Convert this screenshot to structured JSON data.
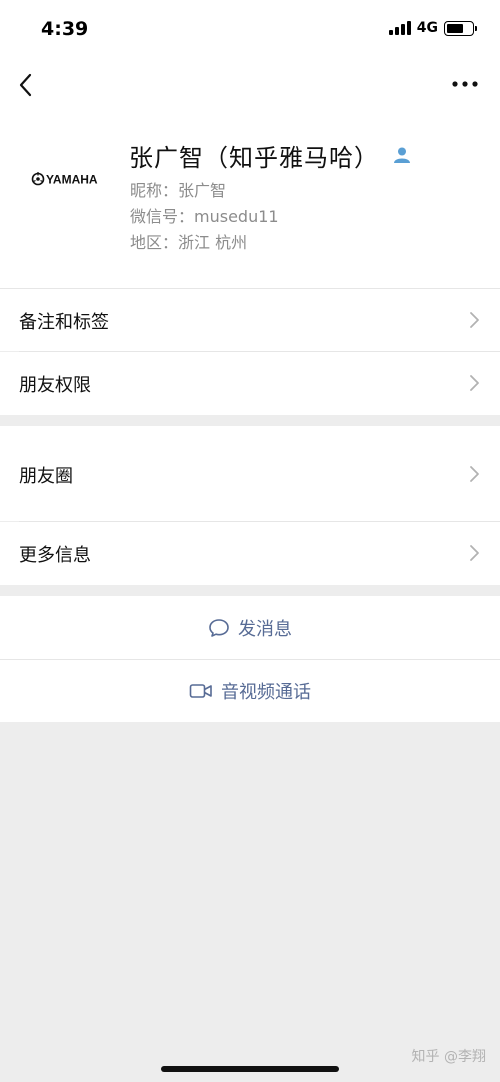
{
  "status_bar": {
    "time": "4:39",
    "network": "4G"
  },
  "nav": {
    "back_icon": "chevron-left-icon",
    "more_icon": "more-dots-icon"
  },
  "profile": {
    "avatar_text": "YAMAHA",
    "name": "张广智（知乎雅马哈）",
    "nickname": "昵称：张广智",
    "wechat_id": "微信号：musedu11",
    "region": "地区：浙江 杭州"
  },
  "menu": {
    "remarks_tags": "备注和标签",
    "friend_permissions": "朋友权限",
    "moments": "朋友圈",
    "more_info": "更多信息"
  },
  "actions": {
    "send_message": "发消息",
    "video_call": "音视频通话"
  },
  "watermark": "知乎 @李翔",
  "colors": {
    "link": "#576b95",
    "background": "#ededed",
    "contact_icon": "#5a9fd4"
  }
}
